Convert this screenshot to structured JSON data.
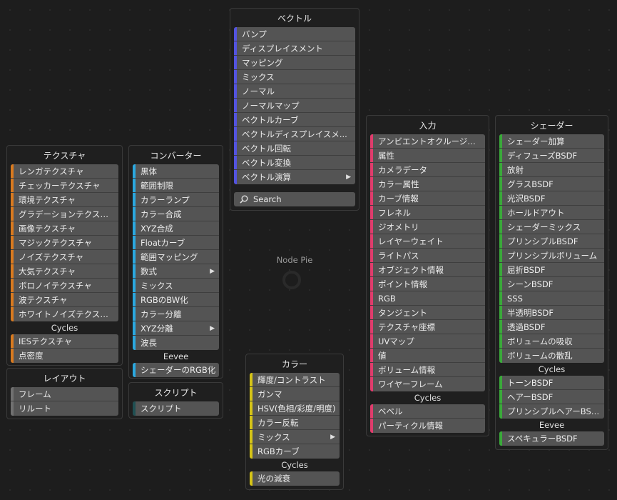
{
  "pie": {
    "label": "Node Pie"
  },
  "colors": {
    "texture": "#d97a1f",
    "converter": "#2aa8e0",
    "layout": "#707070",
    "script": "#1f4f52",
    "vector": "#5353e0",
    "color": "#d6c416",
    "input": "#e03c6c",
    "shader": "#3aaa3a"
  },
  "vector": {
    "title": "ベクトル",
    "items": [
      {
        "label": "バンプ"
      },
      {
        "label": "ディスプレイスメント"
      },
      {
        "label": "マッピング"
      },
      {
        "label": "ミックス"
      },
      {
        "label": "ノーマル"
      },
      {
        "label": "ノーマルマップ"
      },
      {
        "label": "ベクトルカーブ"
      },
      {
        "label": "ベクトルディスプレイスメ..."
      },
      {
        "label": "ベクトル回転"
      },
      {
        "label": "ベクトル変換"
      },
      {
        "label": "ベクトル演算",
        "submenu": true
      }
    ]
  },
  "search": {
    "placeholder": "Search"
  },
  "texture": {
    "title": "テクスチャ",
    "items": [
      {
        "label": "レンガテクスチャ"
      },
      {
        "label": "チェッカーテクスチャ"
      },
      {
        "label": "環境テクスチャ"
      },
      {
        "label": "グラデーションテクスチャ"
      },
      {
        "label": "画像テクスチャ"
      },
      {
        "label": "マジックテクスチャ"
      },
      {
        "label": "ノイズテクスチャ"
      },
      {
        "label": "大気テクスチャ"
      },
      {
        "label": "ボロノイテクスチャ"
      },
      {
        "label": "波テクスチャ"
      },
      {
        "label": "ホワイトノイズテクスチャ"
      }
    ],
    "sub_title": "Cycles",
    "sub_items": [
      {
        "label": "IESテクスチャ"
      },
      {
        "label": "点密度"
      }
    ]
  },
  "layout": {
    "title": "レイアウト",
    "items": [
      {
        "label": "フレーム"
      },
      {
        "label": "リルート"
      }
    ]
  },
  "converter": {
    "title": "コンバーター",
    "items": [
      {
        "label": "黒体"
      },
      {
        "label": "範囲制限"
      },
      {
        "label": "カラーランプ"
      },
      {
        "label": "カラー合成"
      },
      {
        "label": "XYZ合成"
      },
      {
        "label": "Floatカーブ"
      },
      {
        "label": "範囲マッピング"
      },
      {
        "label": "数式",
        "submenu": true
      },
      {
        "label": "ミックス"
      },
      {
        "label": "RGBのBW化"
      },
      {
        "label": "カラー分離"
      },
      {
        "label": "XYZ分離",
        "submenu": true
      },
      {
        "label": "波長"
      }
    ],
    "sub_title": "Eevee",
    "sub_items": [
      {
        "label": "シェーダーのRGB化"
      }
    ]
  },
  "script": {
    "title": "スクリプト",
    "items": [
      {
        "label": "スクリプト"
      }
    ]
  },
  "color": {
    "title": "カラー",
    "items": [
      {
        "label": "輝度/コントラスト"
      },
      {
        "label": "ガンマ"
      },
      {
        "label": "HSV(色相/彩度/明度)"
      },
      {
        "label": "カラー反転"
      },
      {
        "label": "ミックス",
        "submenu": true
      },
      {
        "label": "RGBカーブ"
      }
    ],
    "sub_title": "Cycles",
    "sub_items": [
      {
        "label": "光の減衰"
      }
    ]
  },
  "input": {
    "title": "入力",
    "items": [
      {
        "label": "アンビエントオクルージョン"
      },
      {
        "label": "属性"
      },
      {
        "label": "カメラデータ"
      },
      {
        "label": "カラー属性"
      },
      {
        "label": "カーブ情報"
      },
      {
        "label": "フレネル"
      },
      {
        "label": "ジオメトリ"
      },
      {
        "label": "レイヤーウェイト"
      },
      {
        "label": "ライトパス"
      },
      {
        "label": "オブジェクト情報"
      },
      {
        "label": "ポイント情報"
      },
      {
        "label": "RGB"
      },
      {
        "label": "タンジェント"
      },
      {
        "label": "テクスチャ座標"
      },
      {
        "label": "UVマップ"
      },
      {
        "label": "値"
      },
      {
        "label": "ボリューム情報"
      },
      {
        "label": "ワイヤーフレーム"
      }
    ],
    "sub_title": "Cycles",
    "sub_items": [
      {
        "label": "ベベル"
      },
      {
        "label": "パーティクル情報"
      }
    ]
  },
  "shader": {
    "title": "シェーダー",
    "items": [
      {
        "label": "シェーダー加算"
      },
      {
        "label": "ディフューズBSDF"
      },
      {
        "label": "放射"
      },
      {
        "label": "グラスBSDF"
      },
      {
        "label": "光沢BSDF"
      },
      {
        "label": "ホールドアウト"
      },
      {
        "label": "シェーダーミックス"
      },
      {
        "label": "プリンシプルBSDF"
      },
      {
        "label": "プリンシプルボリューム"
      },
      {
        "label": "屈折BSDF"
      },
      {
        "label": "シーンBSDF"
      },
      {
        "label": "SSS"
      },
      {
        "label": "半透明BSDF"
      },
      {
        "label": "透過BSDF"
      },
      {
        "label": "ボリュームの吸収"
      },
      {
        "label": "ボリュームの散乱"
      }
    ],
    "sub_title": "Cycles",
    "sub_items": [
      {
        "label": "トーンBSDF"
      },
      {
        "label": "ヘアーBSDF"
      },
      {
        "label": "プリンシプルヘアーBSDF"
      }
    ],
    "sub2_title": "Eevee",
    "sub2_items": [
      {
        "label": "スペキュラーBSDF"
      }
    ]
  }
}
